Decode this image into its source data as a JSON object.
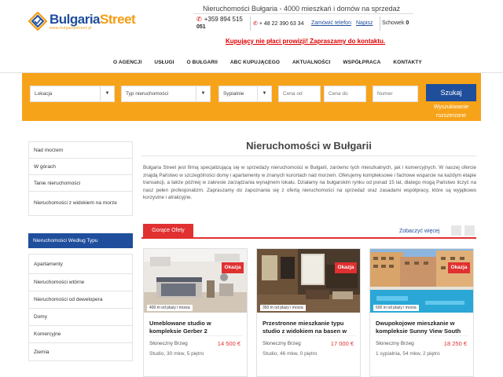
{
  "header": {
    "logo_text_a": "Bulgaria",
    "logo_text_b": "Street",
    "logo_url": "www.bulgariastreet.pl",
    "tagline": "Nieruchomości Bułgaria - 4000 mieszkań i domów na sprzedaż",
    "phone_bg_1": "+359 894 515",
    "phone_bg_2": "051",
    "phone_pl": "+ 48 22 390 63 34",
    "order_call": "Zamówić telefon",
    "write": "Napisz",
    "schowek_label": "Schowek",
    "schowek_count": "0",
    "promo": "Kupujący nie płaci prowizji! Zapraszamy do kontaktu.",
    "colors": {
      "brand_blue": "#1f4e9c",
      "accent_orange": "#f7a31a",
      "promo_red": "#e00000"
    }
  },
  "nav": {
    "items": [
      "O AGENCJI",
      "USŁUGI",
      "O BUŁGARII",
      "ABC KUPUJĄCEGO",
      "AKTUALNOŚCI",
      "WSPÓŁPRACA",
      "KONTAKTY"
    ]
  },
  "search": {
    "location": "Lokacja",
    "type": "Typ nieruchomości",
    "bedrooms": "Sypialnie",
    "price_from": "Cena od",
    "price_to": "Cena do",
    "number": "Numer",
    "button": "Szukaj",
    "advanced_1": "Wyszukiwanie",
    "advanced_2": "rozszerzone"
  },
  "sidebar": {
    "locations": [
      "Nad morzem",
      "W górach",
      "Tanie nieruchomości",
      "Nieruchomości z widokiem na morze"
    ],
    "types_title": "Nieruchomości Według Typu",
    "types": [
      "Apartamenty",
      "Nieruchomości wtórne",
      "Nieruchomości od dewelopera",
      "Domy",
      "Komercyjne",
      "Ziemia"
    ]
  },
  "main": {
    "title": "Nieruchomości w Bułgarii",
    "intro": "Bulgaria Street jest firmą specjalizującą się w sprzedaży nieruchomości w Bułgarii, zarówno tych mieszkalnych, jak i komercyjnych. W naszej ofercie znajdą Państwo w szczególności domy i apartamenty w znanych kurortach nad morzem. Oferujemy kompleksowe i fachowe wsparcie na każdym etapie transakcji, a także później w zakresie zarządzania wynajmem lokalu. Działamy na bułgarskim rynku od ponad 15 lat, dlatego mogą Państwo liczyć na nasz pełen profesjonalizm. Zapraszamy do zapoznania się z ofertą nieruchomości na sprzedaż oraz zasadami współpracy, które są wyjątkowo korzystne i atrakcyjne.",
    "tab": "Gorące Ofety",
    "see_more": "Zobaczyć więcej"
  },
  "offers": [
    {
      "badge": "Okazja",
      "distance": "400 m od plaży i morza",
      "title": "Umeblowane studio w kompleksie Gerber 2",
      "city": "Słoneczny Brzeg",
      "price": "14 500 €",
      "details": "Studio, 30 mkw, 5 piętro"
    },
    {
      "badge": "Okazja",
      "distance": "350 m od plaży i morza",
      "title": "Przestronne mieszkanie typu studio z widokiem na basen w",
      "city": "Słoneczny Brzeg",
      "price": "17 000 €",
      "details": "Studio, 46 mkw, 0 piętro"
    },
    {
      "badge": "Okazja",
      "distance": "600 m od plaży i morza",
      "title": "Dwupokojowe mieszkanie w kompleksie Sunny View South",
      "city": "Słoneczny Brzeg",
      "price": "18 250 €",
      "details": "1 sypialnia, 54 mkw, 2 piętro"
    }
  ]
}
